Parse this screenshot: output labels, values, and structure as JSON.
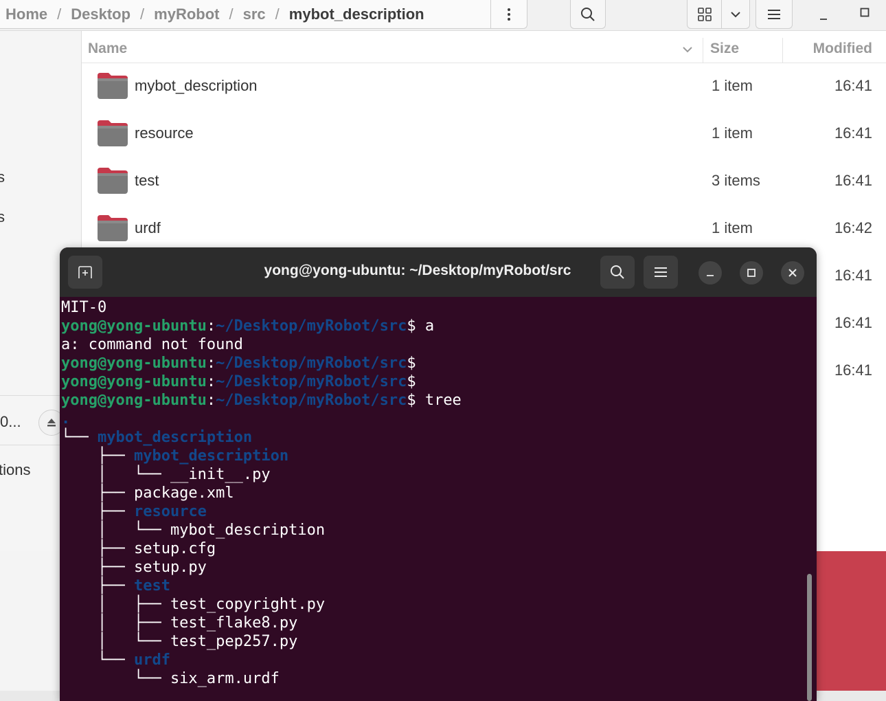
{
  "files": {
    "breadcrumb": [
      "Home",
      "Desktop",
      "myRobot",
      "src",
      "mybot_description"
    ],
    "columns": {
      "name": "Name",
      "size": "Size",
      "modified": "Modified"
    },
    "rows": [
      {
        "name": "mybot_description",
        "size": "1 item",
        "modified": "16:41"
      },
      {
        "name": "resource",
        "size": "1 item",
        "modified": "16:41"
      },
      {
        "name": "test",
        "size": "3 items",
        "modified": "16:41"
      },
      {
        "name": "urdf",
        "size": "1 item",
        "modified": "16:42"
      },
      {
        "name": "",
        "size": "",
        "modified": "16:41"
      },
      {
        "name": "",
        "size": "",
        "modified": "16:41"
      },
      {
        "name": "",
        "size": "",
        "modified": "16:41"
      }
    ],
    "sidebar": {
      "s1": "s",
      "s2": "s",
      "device": "0...",
      "other": "tions"
    }
  },
  "terminal": {
    "title": "yong@yong-ubuntu: ~/Desktop/myRobot/src",
    "user_host": "yong@yong-ubuntu",
    "colon": ":",
    "path": "~/Desktop/myRobot/src",
    "dollar": "$",
    "lines": {
      "l0": "MIT-0",
      "cmd1": " a",
      "l2": "a: command not found",
      "cmd5": " tree",
      "dot": ".",
      "t1a": "└── ",
      "t1b": "mybot_description",
      "t2a": "    ├── ",
      "t2b": "mybot_description",
      "t3": "    │   └── __init__.py",
      "t4": "    ├── package.xml",
      "t5a": "    ├── ",
      "t5b": "resource",
      "t6": "    │   └── mybot_description",
      "t7": "    ├── setup.cfg",
      "t8": "    ├── setup.py",
      "t9a": "    ├── ",
      "t9b": "test",
      "t10": "    │   ├── test_copyright.py",
      "t11": "    │   ├── test_flake8.py",
      "t12": "    │   └── test_pep257.py",
      "t13a": "    └── ",
      "t13b": "urdf",
      "t14": "        └── six_arm.urdf"
    }
  },
  "colors": {
    "terminal_bg": "#300a24",
    "prompt_green": "#26a269",
    "path_blue": "#12488b",
    "desktop_red": "#c7404e"
  }
}
